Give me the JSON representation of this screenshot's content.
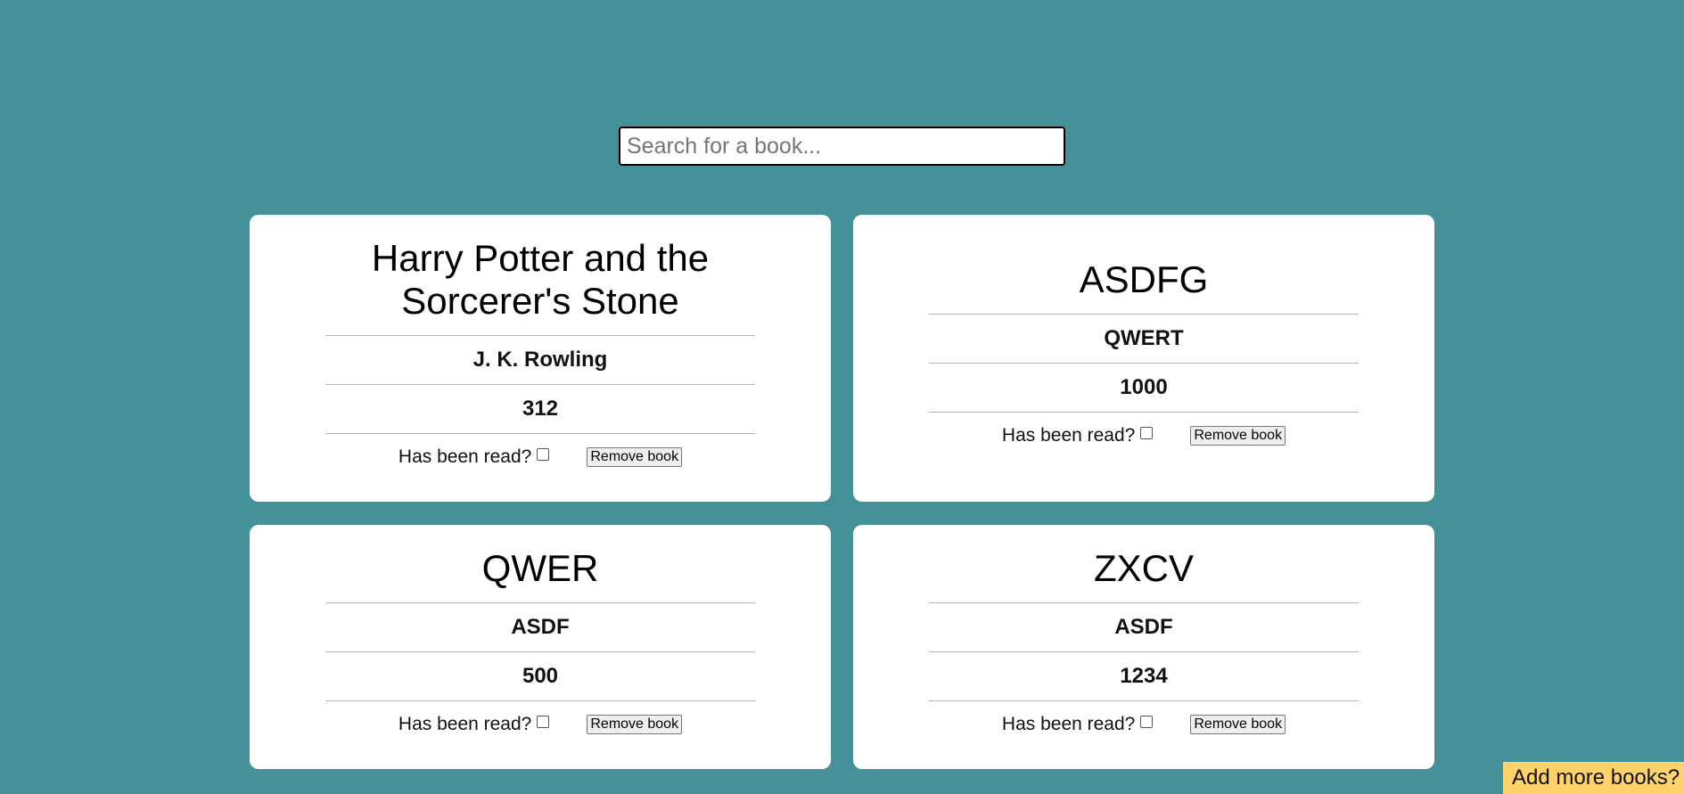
{
  "search": {
    "placeholder": "Search for a book..."
  },
  "books": [
    {
      "title": "Harry Potter and the Sorcerer's Stone",
      "author": "J. K. Rowling",
      "pages": "312",
      "read_label": "Has been read?",
      "read": false,
      "remove_label": "Remove book"
    },
    {
      "title": "ASDFG",
      "author": "QWERT",
      "pages": "1000",
      "read_label": "Has been read?",
      "read": false,
      "remove_label": "Remove book"
    },
    {
      "title": "QWER",
      "author": "ASDF",
      "pages": "500",
      "read_label": "Has been read?",
      "read": false,
      "remove_label": "Remove book"
    },
    {
      "title": "ZXCV",
      "author": "ASDF",
      "pages": "1234",
      "read_label": "Has been read?",
      "read": false,
      "remove_label": "Remove book"
    }
  ],
  "add_more_label": "Add more books?",
  "colors": {
    "background": "#44919a",
    "card": "#ffffff",
    "add_button": "#ffd36b"
  }
}
